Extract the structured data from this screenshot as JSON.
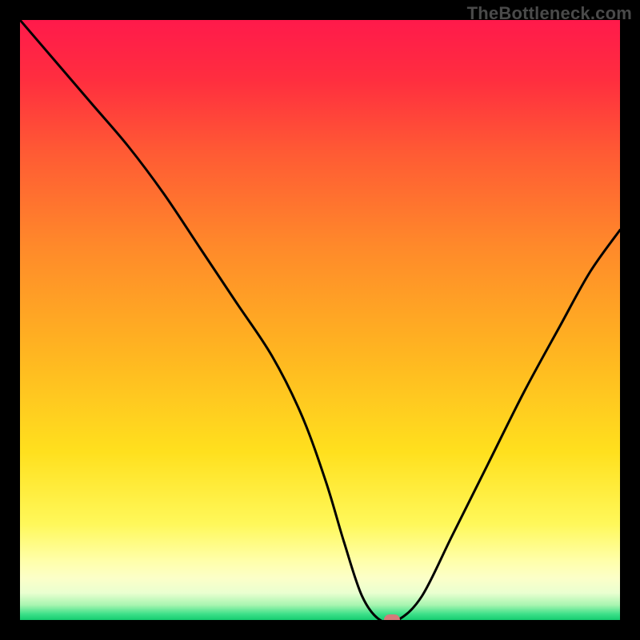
{
  "watermark": "TheBottleneck.com",
  "chart_data": {
    "type": "line",
    "title": "",
    "xlabel": "",
    "ylabel": "",
    "xlim": [
      0,
      100
    ],
    "ylim": [
      0,
      100
    ],
    "x": [
      0,
      6,
      12,
      18,
      24,
      30,
      36,
      42,
      47,
      51,
      54,
      57,
      60,
      63,
      67,
      72,
      78,
      84,
      90,
      95,
      100
    ],
    "values": [
      100,
      93,
      86,
      79,
      71,
      62,
      53,
      44,
      34,
      23,
      13,
      4,
      0,
      0,
      4,
      14,
      26,
      38,
      49,
      58,
      65
    ],
    "marker": {
      "x": 62,
      "y": 0
    },
    "background_gradient": {
      "stops": [
        {
          "offset": 0.0,
          "color": "#ff1a4b"
        },
        {
          "offset": 0.1,
          "color": "#ff2e3f"
        },
        {
          "offset": 0.22,
          "color": "#ff5a34"
        },
        {
          "offset": 0.38,
          "color": "#ff8a2a"
        },
        {
          "offset": 0.55,
          "color": "#ffb421"
        },
        {
          "offset": 0.72,
          "color": "#ffe01e"
        },
        {
          "offset": 0.84,
          "color": "#fff85a"
        },
        {
          "offset": 0.9,
          "color": "#ffffa8"
        },
        {
          "offset": 0.93,
          "color": "#fcffc8"
        },
        {
          "offset": 0.955,
          "color": "#eaffd0"
        },
        {
          "offset": 0.975,
          "color": "#a8f5b0"
        },
        {
          "offset": 0.99,
          "color": "#3de089"
        },
        {
          "offset": 1.0,
          "color": "#15cc70"
        }
      ]
    }
  }
}
